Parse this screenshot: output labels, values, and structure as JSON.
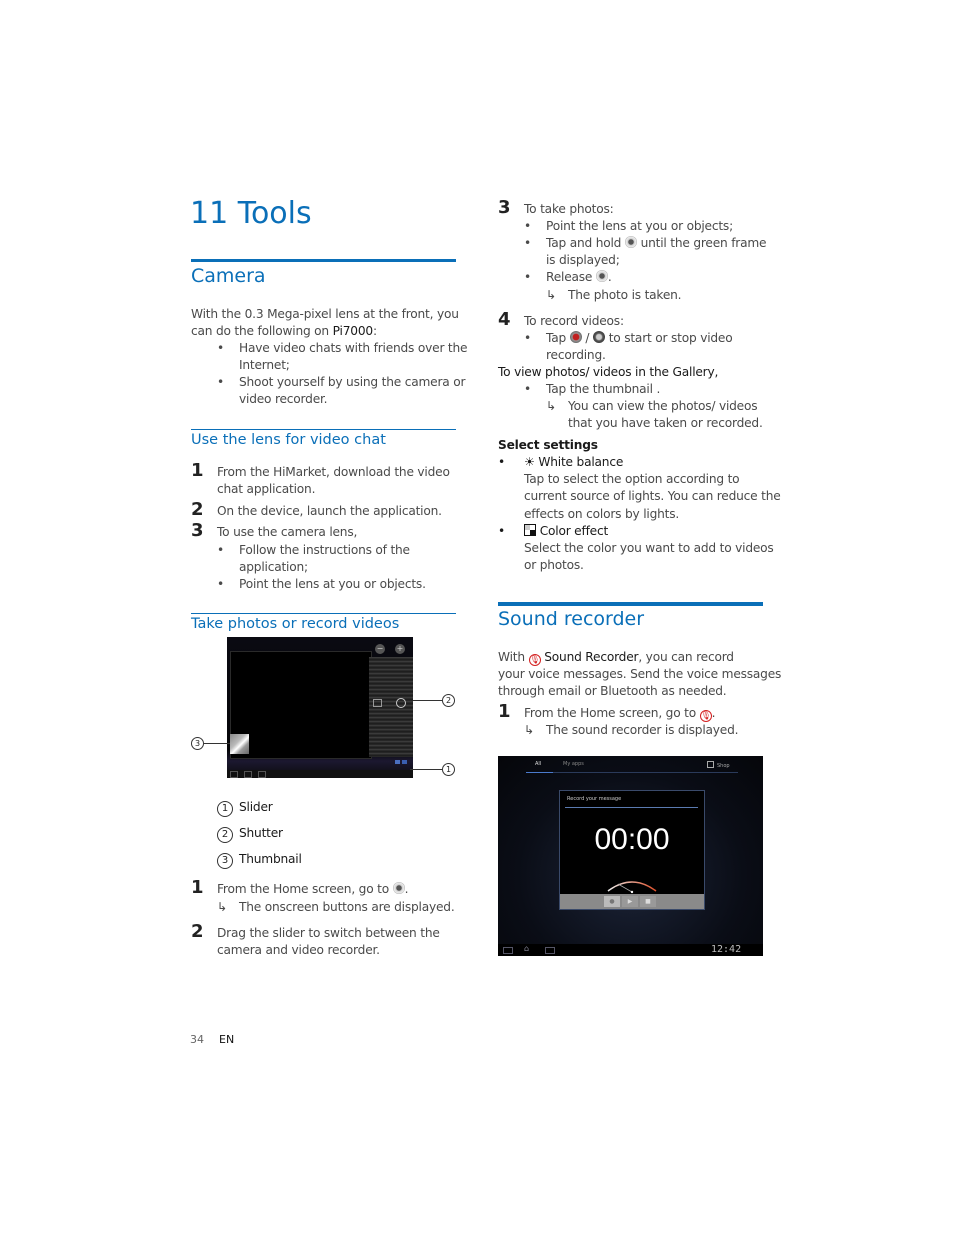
{
  "page": {
    "number": "34",
    "lang": "EN"
  },
  "chapter_title": "11  Tools",
  "camera": {
    "title": "Camera",
    "intro_1": "With the 0.3 Mega-pixel lens at the front, you",
    "intro_2a": "can do the following on ",
    "intro_2b": "Pi7000",
    "intro_2c": ":",
    "bullets": [
      {
        "l1": "Have video chats with friends over the",
        "l2": "Internet;"
      },
      {
        "l1": "Shoot yourself by using the camera or",
        "l2": "video recorder."
      }
    ]
  },
  "video_chat": {
    "title": "Use the lens for video chat",
    "steps": [
      {
        "n": "1",
        "l1": "From the HiMarket, download the video",
        "l2": "chat application."
      },
      {
        "n": "2",
        "l1": "On the device, launch the application."
      },
      {
        "n": "3",
        "l1": "To use the camera lens,"
      }
    ],
    "bullets": [
      {
        "l1": "Follow the instructions of the",
        "l2": "application;"
      },
      {
        "l1": "Point the lens at you or objects."
      }
    ]
  },
  "take_photos": {
    "title": "Take photos or record videos",
    "callouts": [
      {
        "n": "1",
        "label": "Slider"
      },
      {
        "n": "2",
        "label": "Shutter"
      },
      {
        "n": "3",
        "label": "Thumbnail"
      }
    ],
    "step1": {
      "n": "1",
      "text": "From the Home screen, go to",
      "result": "The onscreen buttons are displayed."
    },
    "step2": {
      "n": "2",
      "l1": "Drag the slider to switch between the",
      "l2": "camera and video recorder."
    },
    "step3": {
      "n": "3",
      "text": "To take photos:",
      "b1": "Point the lens at you or objects;",
      "b2a": "Tap and hold",
      "b2b": "until the green frame",
      "b2c": "is displayed;",
      "b3": "Release",
      "result": "The photo is taken."
    },
    "step4": {
      "n": "4",
      "text": "To record videos:",
      "b1a": "Tap",
      "b1b": "/",
      "b1c": "to start or stop video",
      "b1d": "recording."
    },
    "gallery": {
      "title": "To view photos/ videos in the Gallery,",
      "b1": "Tap the thumbnail .",
      "r1": "You can view the photos/ videos",
      "r2": "that you have taken or recorded."
    }
  },
  "settings": {
    "title": "Select settings",
    "items": [
      {
        "icon": "sun-icon",
        "name": "White balance",
        "d1": "Tap to select the option according to",
        "d2": "current source of lights. You can reduce the",
        "d3": "effects on colors by lights."
      },
      {
        "icon": "color-effect-icon",
        "name": "Color effect",
        "d1": "Select the color you want to add to videos",
        "d2": "or photos."
      }
    ]
  },
  "sound_recorder": {
    "title": "Sound recorder",
    "intro_a": "With",
    "intro_b": "Sound Recorder",
    "intro_c": ", you can record",
    "intro_2": "your voice messages. Send the voice messages",
    "intro_3": "through email or Bluetooth as needed.",
    "step1": {
      "n": "1",
      "text": "From the Home screen, go to",
      "result": "The sound recorder is displayed."
    },
    "screen": {
      "tab_all": "All",
      "tab_myapps": "My apps",
      "shop": "Shop",
      "dialog_title": "Record your message",
      "timer": "00:00",
      "clock": "12:42"
    }
  },
  "colors": {
    "accent": "#0a6fb8",
    "mic": "#d42020"
  }
}
